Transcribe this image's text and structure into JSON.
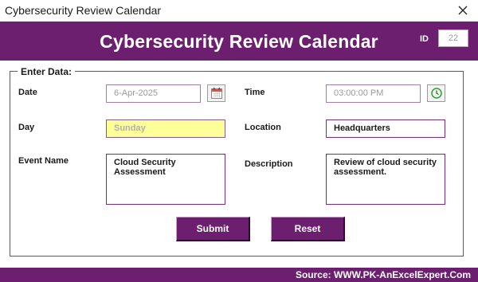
{
  "window": {
    "title": "Cybersecurity Review Calendar",
    "close_icon": "close-icon"
  },
  "header": {
    "title": "Cybersecurity Review Calendar",
    "id_label": "ID",
    "id_value": "22"
  },
  "form": {
    "legend": "Enter Data:",
    "date": {
      "label": "Date",
      "value": "6-Apr-2025",
      "icon": "calendar-icon"
    },
    "time": {
      "label": "Time",
      "value": "03:00:00 PM",
      "icon": "clock-icon"
    },
    "day": {
      "label": "Day",
      "value": "Sunday"
    },
    "location": {
      "label": "Location",
      "value": "Headquarters"
    },
    "event_name": {
      "label": "Event Name",
      "value": "Cloud Security\nAssessment"
    },
    "description": {
      "label": "Description",
      "value": "Review of cloud security\nassessment."
    }
  },
  "buttons": {
    "submit": "Submit",
    "reset": "Reset"
  },
  "footer": {
    "source": "Source: WWW.PK-AnExcelExpert.Com"
  },
  "colors": {
    "accent": "#6b1f6e",
    "highlight_field": "#ffff99"
  }
}
